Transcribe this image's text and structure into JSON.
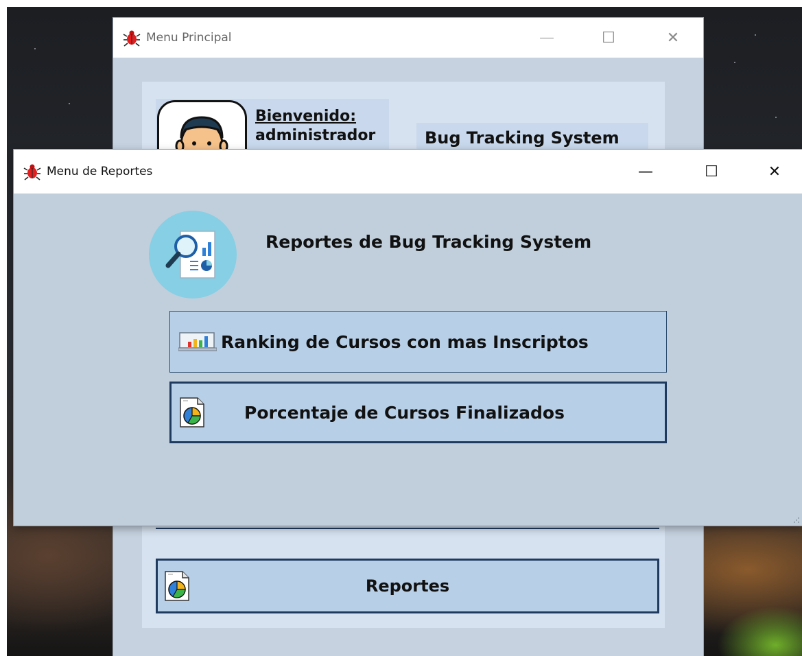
{
  "back_window": {
    "title": "Menu Principal",
    "welcome_label": "Bienvenido:",
    "username": "administrador",
    "app_name": "Bug Tracking System",
    "reportes_button": "Reportes"
  },
  "front_window": {
    "title": "Menu de Reportes",
    "heading": "Reportes de Bug Tracking System",
    "buttons": [
      {
        "label": "Ranking de Cursos con mas Inscriptos",
        "icon": "bar-chart-icon"
      },
      {
        "label": "Porcentaje de Cursos Finalizados",
        "icon": "pie-chart-icon"
      }
    ]
  },
  "window_controls": {
    "minimize": "—",
    "maximize": "☐",
    "close": "✕"
  },
  "colors": {
    "window_bg": "#c1cfdc",
    "button_bg": "#b8cfe8",
    "button_border": "#1e3a5f",
    "icon_circle": "#86cfe4"
  }
}
